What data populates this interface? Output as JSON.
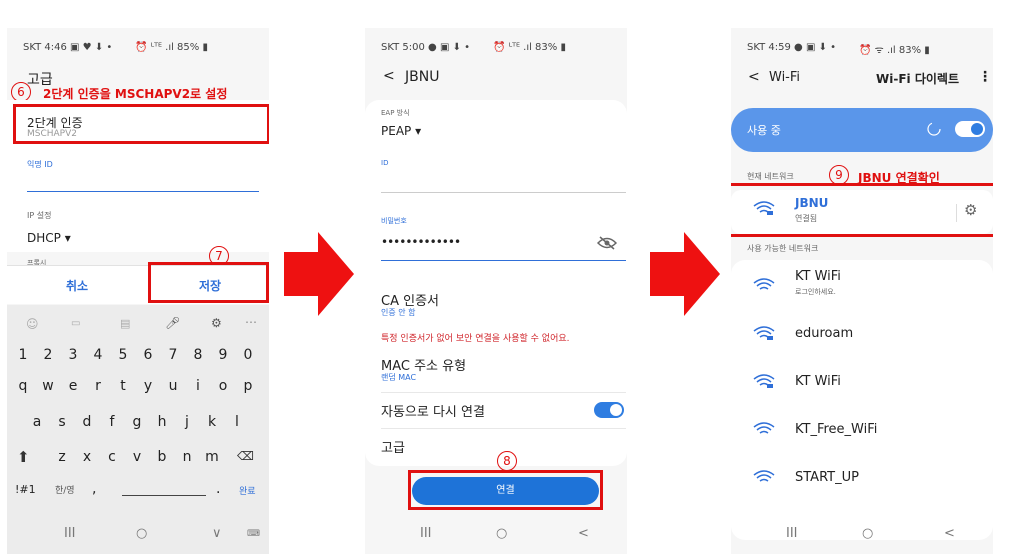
{
  "p1": {
    "status_left": "SKT 4:46 ▣ ♥ ⬇ •",
    "status_right": "⏰ ᴸᵀᴱ .ıl 85% ▮",
    "header": "고급",
    "step6_num": "6",
    "step6_text": "2단계 인증을 MSCHAPV2로 설정",
    "phase2_label": "2단계 인증",
    "phase2_value": "MSCHAPV2",
    "anon_label": "익명 ID",
    "ip_label": "IP 설정",
    "ip_value": "DHCP",
    "proxy_label": "프록시",
    "step7_num": "7",
    "cancel": "취소",
    "save": "저장",
    "row_numbers": [
      "1",
      "2",
      "3",
      "4",
      "5",
      "6",
      "7",
      "8",
      "9",
      "0"
    ],
    "row_q": [
      "q",
      "w",
      "e",
      "r",
      "t",
      "y",
      "u",
      "i",
      "o",
      "p"
    ],
    "row_a": [
      "a",
      "s",
      "d",
      "f",
      "g",
      "h",
      "j",
      "k",
      "l"
    ],
    "row_z": [
      "z",
      "x",
      "c",
      "v",
      "b",
      "n",
      "m"
    ],
    "key_sym": "!#1",
    "key_lang": "한/영",
    "key_comma": ",",
    "key_dot": ".",
    "key_done": "완료"
  },
  "p2": {
    "status_left": "SKT 5:00 ● ▣ ⬇ •",
    "status_right": "⏰ ᴸᵀᴱ .ıl 83% ▮",
    "back": "<",
    "title": "JBNU",
    "eap_label": "EAP 방식",
    "eap_value": "PEAP",
    "id_label": "ID",
    "pw_label": "비밀번호",
    "pw_value": "•••••••••••••",
    "ca_label": "CA 인증서",
    "ca_value": "인증 안 함",
    "warning": "특정 인증서가 없어 보안 연결을 사용할 수 없어요.",
    "mac_label": "MAC 주소 유형",
    "mac_value": "랜덤 MAC",
    "auto_reconnect": "자동으로 다시 연결",
    "advanced": "고급",
    "step8_num": "8",
    "connect": "연결"
  },
  "p3": {
    "status_left": "SKT 4:59 ● ▣ ⬇ •",
    "status_right": "⏰ ᯤ .ıl 83% ▮",
    "back": "<",
    "title": "Wi-Fi",
    "wifi_direct": "Wi-Fi 다이렉트",
    "menu": "⋮",
    "in_use": "사용 중",
    "current_network": "현재 네트워크",
    "step9_num": "9",
    "step9_text": "JBNU 연결확인",
    "connected_name": "JBNU",
    "connected_status": "연결됨",
    "available": "사용 가능한 네트워크",
    "networks": [
      {
        "name": "KT WiFi",
        "sub": "로그인하세요."
      },
      {
        "name": "eduroam",
        "sub": ""
      },
      {
        "name": "KT WiFi",
        "sub": ""
      },
      {
        "name": "KT_Free_WiFi",
        "sub": ""
      },
      {
        "name": "START_UP",
        "sub": ""
      }
    ]
  },
  "nav": {
    "recents": "III",
    "home": "○",
    "back": "<",
    "down": "∨"
  },
  "colors": {
    "annotation": "#e01010",
    "accent": "#2f6fd8",
    "arrow": "#ee1111"
  }
}
